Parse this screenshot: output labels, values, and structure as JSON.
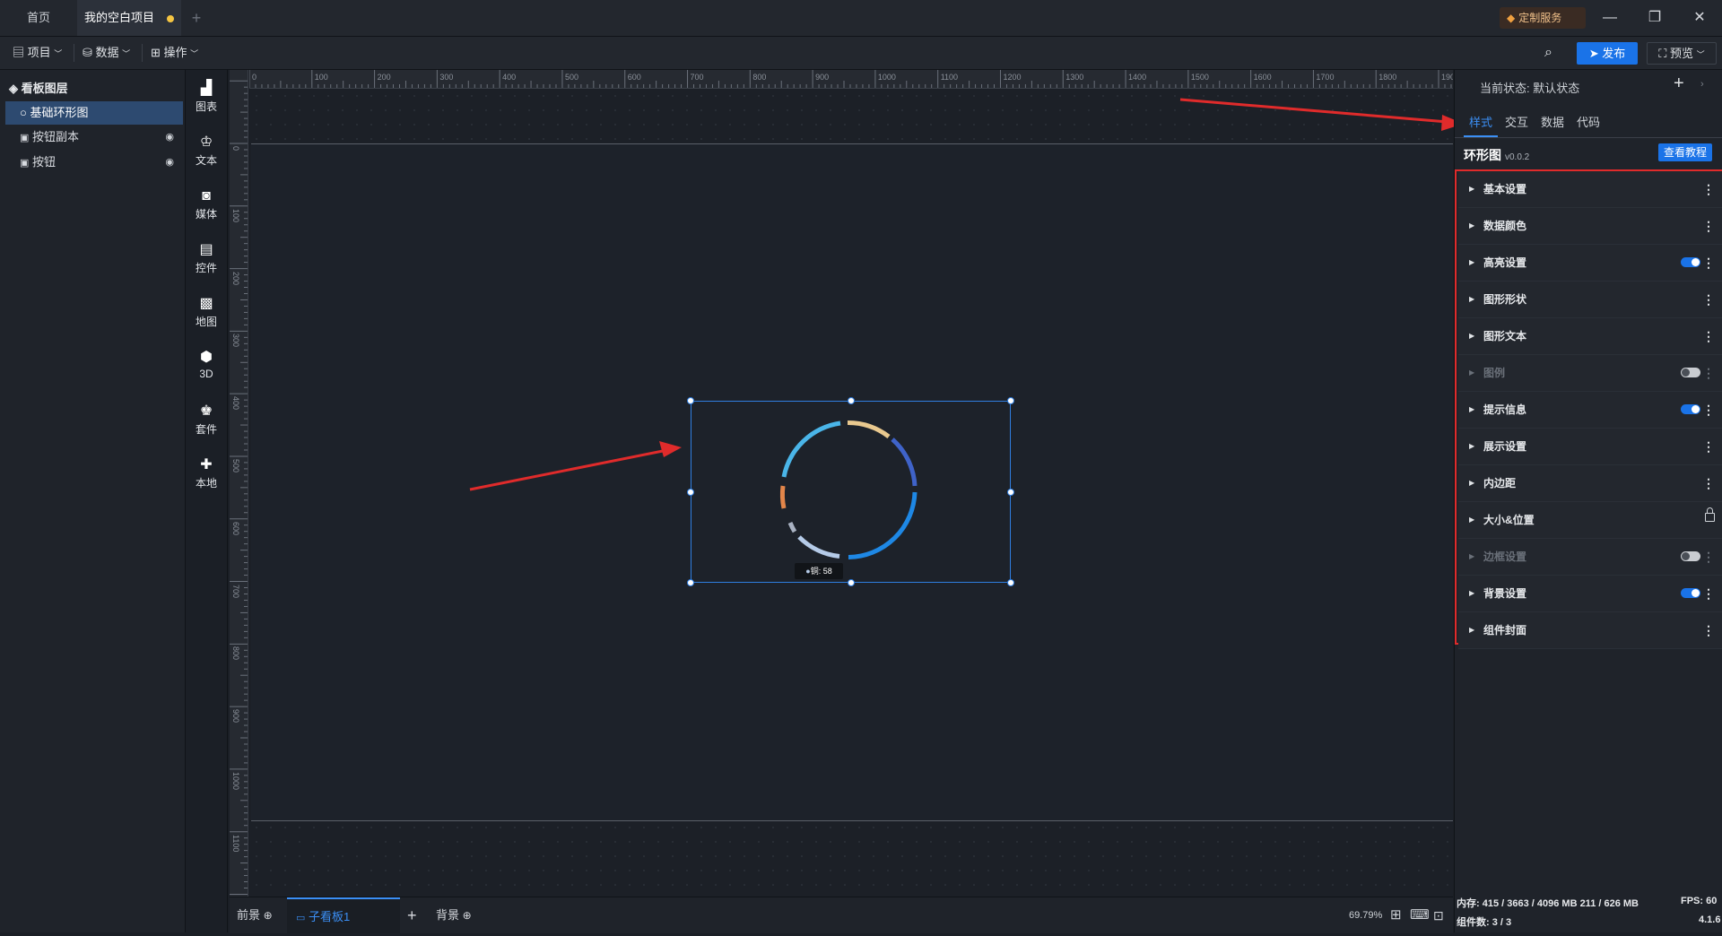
{
  "tabs": {
    "home": "首页",
    "project": "我的空白项目",
    "service": "定制服务"
  },
  "toolbar": {
    "project": "项目",
    "data": "数据",
    "operate": "操作",
    "publish": "发布",
    "preview": "预览"
  },
  "layers": {
    "title": "看板图层",
    "items": [
      {
        "label": "基础环形图",
        "selected": true
      },
      {
        "label": "按钮副本",
        "selected": false
      },
      {
        "label": "按钮",
        "selected": false
      }
    ]
  },
  "components": [
    {
      "label": "图表",
      "icon": "bar-chart-icon"
    },
    {
      "label": "文本",
      "icon": "text-icon"
    },
    {
      "label": "媒体",
      "icon": "media-icon"
    },
    {
      "label": "控件",
      "icon": "control-icon"
    },
    {
      "label": "地图",
      "icon": "map-icon"
    },
    {
      "label": "3D",
      "icon": "cube-icon"
    },
    {
      "label": "套件",
      "icon": "suite-icon"
    },
    {
      "label": "本地",
      "icon": "puzzle-icon"
    }
  ],
  "ruler": {
    "top": [
      "0",
      "100",
      "200",
      "300",
      "400",
      "500",
      "600",
      "700",
      "800",
      "900",
      "1000",
      "1100",
      "1200",
      "1300",
      "1400",
      "1500",
      "1600",
      "1700",
      "1800",
      "1900"
    ],
    "left": [
      "0",
      "100",
      "200",
      "300",
      "400",
      "500",
      "600",
      "700",
      "800",
      "900",
      "1000",
      "1100",
      "1200"
    ]
  },
  "canvas": {
    "tooltip": "铜: 58"
  },
  "board_tabs": {
    "foreground": "前景",
    "sub": "子看板1",
    "background": "背景",
    "zoom": "69.79%"
  },
  "right": {
    "state": "当前状态:  默认状态",
    "tabs": [
      "样式",
      "交互",
      "数据",
      "代码"
    ],
    "component_name": "环形图",
    "version": "v0.0.2",
    "tutorial": "查看教程",
    "settings": [
      {
        "label": "基本设置",
        "control": "none",
        "disabled": false
      },
      {
        "label": "数据颜色",
        "control": "none",
        "disabled": false
      },
      {
        "label": "高亮设置",
        "control": "on",
        "disabled": false
      },
      {
        "label": "图形形状",
        "control": "none",
        "disabled": false
      },
      {
        "label": "图形文本",
        "control": "none",
        "disabled": false
      },
      {
        "label": "图例",
        "control": "off",
        "disabled": true
      },
      {
        "label": "提示信息",
        "control": "on",
        "disabled": false
      },
      {
        "label": "展示设置",
        "control": "none",
        "disabled": false
      },
      {
        "label": "内边距",
        "control": "none",
        "disabled": false
      },
      {
        "label": "大小&位置",
        "control": "lock",
        "disabled": false
      },
      {
        "label": "边框设置",
        "control": "off",
        "disabled": true
      },
      {
        "label": "背景设置",
        "control": "on",
        "disabled": false
      },
      {
        "label": "组件封面",
        "control": "none",
        "disabled": false
      }
    ]
  },
  "status": {
    "memory": "内存:  415 / 3663 / 4096 MB   211 / 626 MB",
    "fps": "FPS:  60",
    "components": "组件数: 3 / 3",
    "version": "4.1.6"
  },
  "colors": {
    "accent": "#1a73e8",
    "highlight_box": "#e02b2b"
  }
}
